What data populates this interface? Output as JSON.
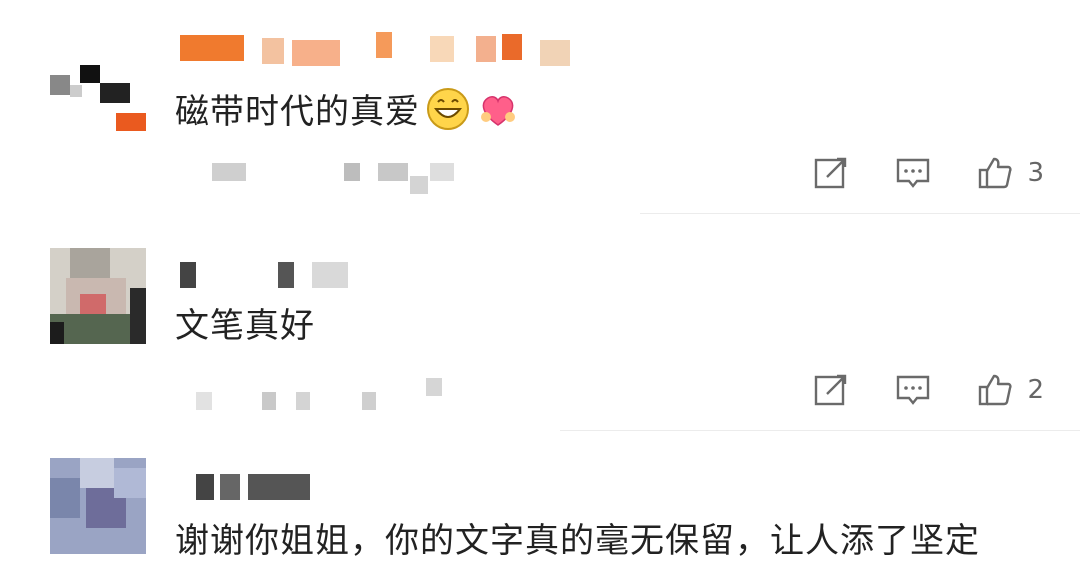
{
  "comments": [
    {
      "text": "磁带时代的真爱",
      "emojis": [
        "grinning-face",
        "heart-with-hands"
      ],
      "actions": {
        "likes": "3"
      }
    },
    {
      "text": "文笔真好",
      "emojis": [],
      "actions": {
        "likes": "2"
      }
    },
    {
      "text": "谢谢你姐姐，你的文字真的毫无保留，让人添了坚定",
      "emojis": [],
      "actions": {
        "likes": ""
      }
    }
  ],
  "colors": {
    "text": "#222222",
    "icon": "#6a6a6a",
    "divider": "#ececec",
    "username_orange": "#f07a2e"
  }
}
